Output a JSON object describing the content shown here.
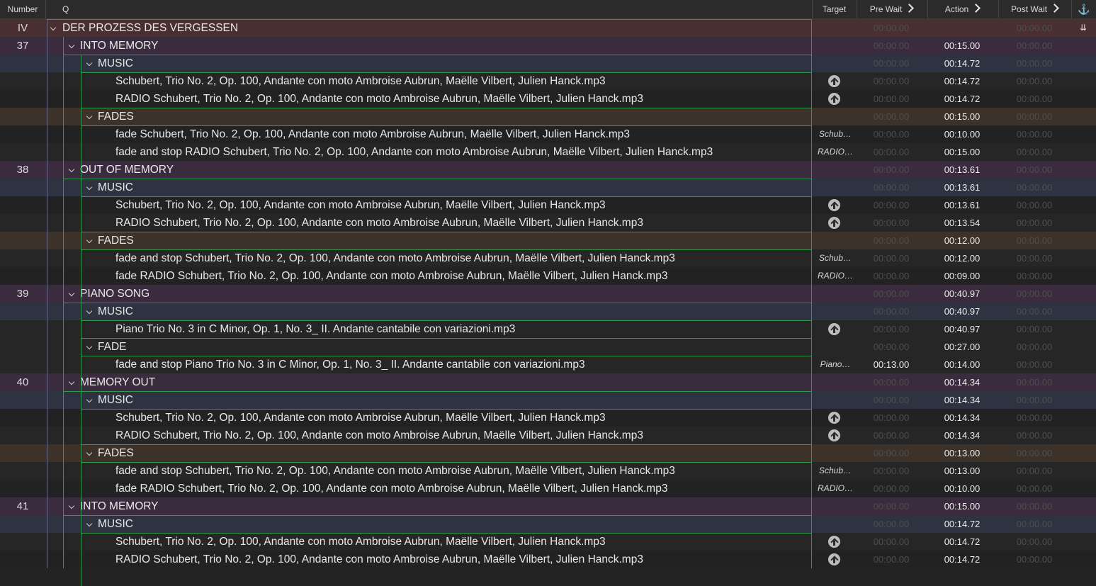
{
  "header": {
    "number": "Number",
    "q": "Q",
    "target": "Target",
    "pre_wait": "Pre Wait",
    "action": "Action",
    "post_wait": "Post Wait",
    "anchor_icon": "anchor-icon"
  },
  "rows": [
    {
      "type": "top",
      "num": "IV",
      "name": "DER PROZESS DES VERGESSEN",
      "target": "",
      "pre": "00:00.00",
      "action": "",
      "post": "00:00.00"
    },
    {
      "type": "cue",
      "num": "37",
      "name": "INTO MEMORY",
      "target": "",
      "pre": "00:00.00",
      "action": "00:15.00",
      "post": "00:00.00"
    },
    {
      "type": "music",
      "num": "",
      "name": "MUSIC",
      "target": "",
      "pre": "00:00.00",
      "action": "00:14.72",
      "post": "00:00.00"
    },
    {
      "type": "child",
      "num": "",
      "name": "Schubert, Trio No. 2, Op. 100, Andante con moto  Ambroise Aubrun, Maëlle Vilbert, Julien Hanck.mp3",
      "target": "icon",
      "pre": "00:00.00",
      "action": "00:14.72",
      "post": "00:00.00"
    },
    {
      "type": "child",
      "num": "",
      "name": "RADIO Schubert, Trio No. 2, Op. 100, Andante con moto  Ambroise Aubrun, Maëlle Vilbert, Julien Hanck.mp3",
      "target": "icon",
      "pre": "00:00.00",
      "action": "00:14.72",
      "post": "00:00.00"
    },
    {
      "type": "fades",
      "num": "",
      "name": "FADES",
      "target": "",
      "pre": "00:00.00",
      "action": "00:15.00",
      "post": "00:00.00"
    },
    {
      "type": "child",
      "num": "",
      "name": "fade Schubert, Trio No. 2, Op. 100, Andante con moto  Ambroise Aubrun, Maëlle Vilbert, Julien Hanck.mp3",
      "target": "Schub…",
      "pre": "00:00.00",
      "action": "00:10.00",
      "post": "00:00.00"
    },
    {
      "type": "child",
      "num": "",
      "name": "fade and stop RADIO Schubert, Trio No. 2, Op. 100, Andante con moto  Ambroise Aubrun, Maëlle Vilbert, Julien Hanck.mp3",
      "target": "RADIO…",
      "pre": "00:00.00",
      "action": "00:15.00",
      "post": "00:00.00"
    },
    {
      "type": "cue",
      "num": "38",
      "name": "OUT OF MEMORY",
      "target": "",
      "pre": "00:00.00",
      "action": "00:13.61",
      "post": "00:00.00"
    },
    {
      "type": "music",
      "num": "",
      "name": "MUSIC",
      "target": "",
      "pre": "00:00.00",
      "action": "00:13.61",
      "post": "00:00.00"
    },
    {
      "type": "child",
      "num": "",
      "name": "Schubert, Trio No. 2, Op. 100, Andante con moto  Ambroise Aubrun, Maëlle Vilbert, Julien Hanck.mp3",
      "target": "icon",
      "pre": "00:00.00",
      "action": "00:13.61",
      "post": "00:00.00"
    },
    {
      "type": "child",
      "num": "",
      "name": "RADIO Schubert, Trio No. 2, Op. 100, Andante con moto  Ambroise Aubrun, Maëlle Vilbert, Julien Hanck.mp3",
      "target": "icon",
      "pre": "00:00.00",
      "action": "00:13.54",
      "post": "00:00.00"
    },
    {
      "type": "fades",
      "num": "",
      "name": "FADES",
      "target": "",
      "pre": "00:00.00",
      "action": "00:12.00",
      "post": "00:00.00"
    },
    {
      "type": "child",
      "num": "",
      "name": "fade and stop Schubert, Trio No. 2, Op. 100, Andante con moto  Ambroise Aubrun, Maëlle Vilbert, Julien Hanck.mp3",
      "target": "Schub…",
      "pre": "00:00.00",
      "action": "00:12.00",
      "post": "00:00.00"
    },
    {
      "type": "child",
      "num": "",
      "name": "fade RADIO Schubert, Trio No. 2, Op. 100, Andante con moto  Ambroise Aubrun, Maëlle Vilbert, Julien Hanck.mp3",
      "target": "RADIO…",
      "pre": "00:00.00",
      "action": "00:09.00",
      "post": "00:00.00"
    },
    {
      "type": "cue",
      "num": "39",
      "name": "PIANO SONG",
      "target": "",
      "pre": "00:00.00",
      "action": "00:40.97",
      "post": "00:00.00"
    },
    {
      "type": "music",
      "num": "",
      "name": "MUSIC",
      "target": "",
      "pre": "00:00.00",
      "action": "00:40.97",
      "post": "00:00.00"
    },
    {
      "type": "child",
      "num": "",
      "name": "Piano Trio No. 3 in C Minor, Op. 1, No. 3_ II. Andante cantabile con variazioni.mp3",
      "target": "icon",
      "pre": "00:00.00",
      "action": "00:40.97",
      "post": "00:00.00"
    },
    {
      "type": "plain",
      "num": "",
      "name": "FADE",
      "target": "",
      "pre": "00:00.00",
      "action": "00:27.00",
      "post": "00:00.00"
    },
    {
      "type": "child",
      "num": "",
      "name": "fade and stop Piano Trio No. 3 in C Minor, Op. 1, No. 3_ II. Andante cantabile con variazioni.mp3",
      "target": "Piano…",
      "pre": "00:13.00",
      "pre_active": true,
      "action": "00:14.00",
      "post": "00:00.00"
    },
    {
      "type": "cue",
      "num": "40",
      "name": "MEMORY OUT",
      "target": "",
      "pre": "00:00.00",
      "action": "00:14.34",
      "post": "00:00.00"
    },
    {
      "type": "music",
      "num": "",
      "name": "MUSIC",
      "target": "",
      "pre": "00:00.00",
      "action": "00:14.34",
      "post": "00:00.00"
    },
    {
      "type": "child",
      "num": "",
      "name": "Schubert, Trio No. 2, Op. 100, Andante con moto  Ambroise Aubrun, Maëlle Vilbert, Julien Hanck.mp3",
      "target": "icon",
      "pre": "00:00.00",
      "action": "00:14.34",
      "post": "00:00.00"
    },
    {
      "type": "child",
      "num": "",
      "name": "RADIO Schubert, Trio No. 2, Op. 100, Andante con moto  Ambroise Aubrun, Maëlle Vilbert, Julien Hanck.mp3",
      "target": "icon",
      "pre": "00:00.00",
      "action": "00:14.34",
      "post": "00:00.00"
    },
    {
      "type": "fades",
      "num": "",
      "name": "FADES",
      "target": "",
      "pre": "00:00.00",
      "action": "00:13.00",
      "post": "00:00.00"
    },
    {
      "type": "child",
      "num": "",
      "name": "fade and stop Schubert, Trio No. 2, Op. 100, Andante con moto  Ambroise Aubrun, Maëlle Vilbert, Julien Hanck.mp3",
      "target": "Schub…",
      "pre": "00:00.00",
      "action": "00:13.00",
      "post": "00:00.00"
    },
    {
      "type": "child",
      "num": "",
      "name": "fade RADIO Schubert, Trio No. 2, Op. 100, Andante con moto  Ambroise Aubrun, Maëlle Vilbert, Julien Hanck.mp3",
      "target": "RADIO…",
      "pre": "00:00.00",
      "action": "00:10.00",
      "post": "00:00.00"
    },
    {
      "type": "cue",
      "num": "41",
      "name": "INTO MEMORY",
      "target": "",
      "pre": "00:00.00",
      "action": "00:15.00",
      "post": "00:00.00"
    },
    {
      "type": "music",
      "num": "",
      "name": "MUSIC",
      "target": "",
      "pre": "00:00.00",
      "action": "00:14.72",
      "post": "00:00.00"
    },
    {
      "type": "child",
      "num": "",
      "name": "Schubert, Trio No. 2, Op. 100, Andante con moto  Ambroise Aubrun, Maëlle Vilbert, Julien Hanck.mp3",
      "target": "icon",
      "pre": "00:00.00",
      "action": "00:14.72",
      "post": "00:00.00"
    },
    {
      "type": "child",
      "num": "",
      "name": "RADIO Schubert, Trio No. 2, Op. 100, Andante con moto  Ambroise Aubrun, Maëlle Vilbert, Julien Hanck.mp3",
      "target": "icon",
      "pre": "00:00.00",
      "action": "00:14.72",
      "post": "00:00.00"
    }
  ]
}
